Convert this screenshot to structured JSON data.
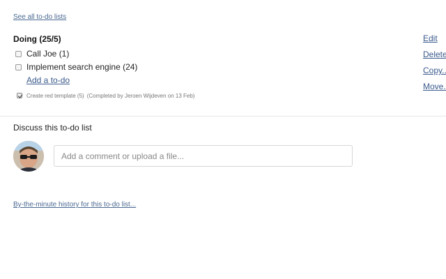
{
  "nav": {
    "see_all_label": "See all to-do lists"
  },
  "todo_list": {
    "title": "Doing (25/5)",
    "items": [
      {
        "label": "Call Joe (1)",
        "checked": false
      },
      {
        "label": "Implement search engine (24)",
        "checked": false
      }
    ],
    "add_todo_label": "Add a to-do",
    "completed": [
      {
        "label": "Create red template (5)",
        "meta": "(Completed by Jeroen Wijdeven on 13 Feb)",
        "checked": true
      }
    ]
  },
  "side_actions": [
    {
      "label": "Edit"
    },
    {
      "label": "Delete"
    },
    {
      "label": "Copy..."
    },
    {
      "label": "Move..."
    }
  ],
  "discussion": {
    "title": "Discuss this to-do list",
    "comment_placeholder": "Add a comment or upload a file..."
  },
  "footer": {
    "history_label": "By-the-minute history for this to-do list..."
  },
  "colors": {
    "link": "#3a5a8c",
    "divider": "#e6e6e6",
    "input_border": "#d6d6d6"
  }
}
